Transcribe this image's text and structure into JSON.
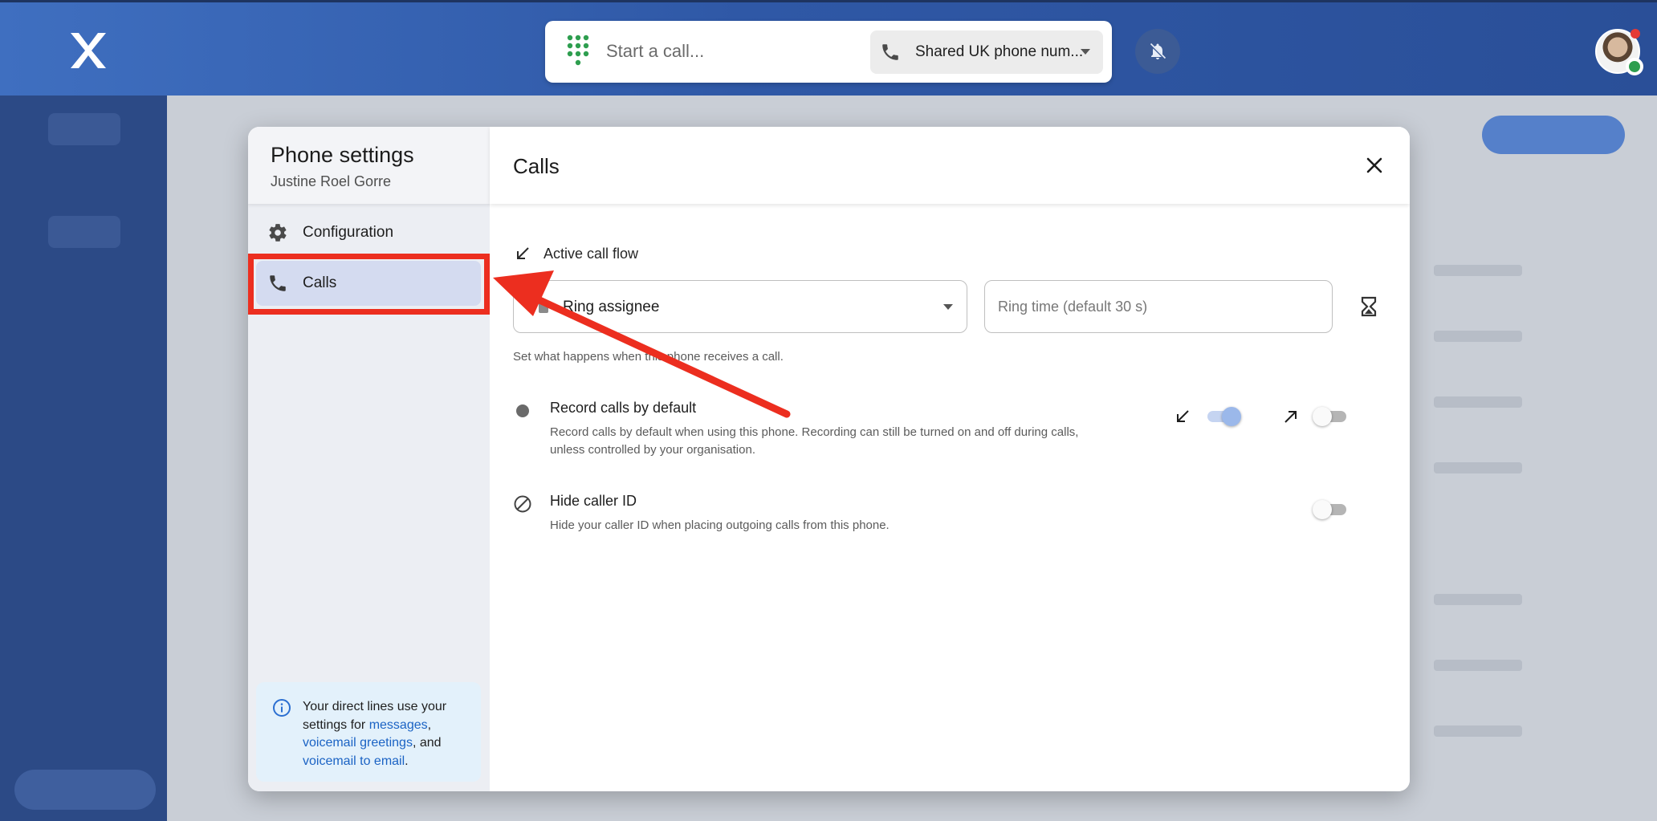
{
  "topbar": {
    "call_placeholder": "Start a call...",
    "number_select_label": "Shared UK phone num..."
  },
  "modal": {
    "sidebar": {
      "title": "Phone settings",
      "subtitle": "Justine Roel Gorre",
      "items": [
        {
          "label": "Configuration",
          "icon": "gear-icon",
          "selected": false
        },
        {
          "label": "Calls",
          "icon": "phone-icon",
          "selected": true
        }
      ],
      "info": {
        "text_before": "Your direct lines use your settings for ",
        "link_messages": "messages",
        "sep1": ", ",
        "link_greetings": "voicemail greetings",
        "sep2": ", and ",
        "link_email": "voicemail to email",
        "end": "."
      }
    },
    "content": {
      "title": "Calls",
      "active_call_flow_label": "Active call flow",
      "ring_select_value": "Ring assignee",
      "ring_time_placeholder": "Ring time (default 30 s)",
      "helper_text": "Set what happens when this phone receives a call.",
      "record": {
        "title": "Record calls by default",
        "description": "Record calls by default when using this phone. Recording can still be turned on and off during calls, unless controlled by your organisation.",
        "incoming_on": true,
        "outgoing_on": false
      },
      "hide_caller": {
        "title": "Hide caller ID",
        "description": "Hide your caller ID when placing outgoing calls from this phone.",
        "on": false
      }
    }
  },
  "annotation": {
    "color": "#ec2e1f"
  }
}
